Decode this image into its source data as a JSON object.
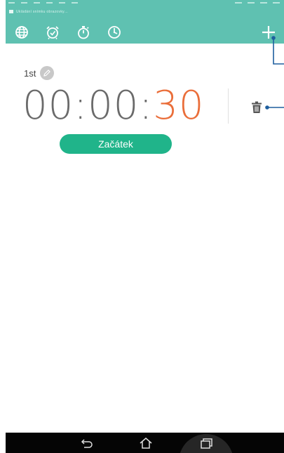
{
  "status_bar": {
    "notice_text": "Ukládání snímku obrazovky…"
  },
  "toolbar": {
    "tabs": [
      {
        "icon": "globe-icon",
        "label": "World clock"
      },
      {
        "icon": "alarm-clock-icon",
        "label": "Alarm"
      },
      {
        "icon": "stopwatch-icon",
        "label": "Stopwatch"
      },
      {
        "icon": "timer-icon",
        "label": "Timer"
      }
    ],
    "add_icon": "plus-icon"
  },
  "timer": {
    "label": "1st",
    "hours": "00",
    "minutes": "00",
    "seconds": "30",
    "separator": ":",
    "start_label": "Začátek"
  },
  "colors": {
    "accent": "#5fc1b1",
    "start_button": "#20b48a",
    "seconds": "#ea6e3a",
    "digits": "#6a6a6a",
    "callout": "#1e5f9e"
  },
  "nav": {
    "buttons": [
      "back-icon",
      "home-icon",
      "recent-apps-icon"
    ]
  }
}
